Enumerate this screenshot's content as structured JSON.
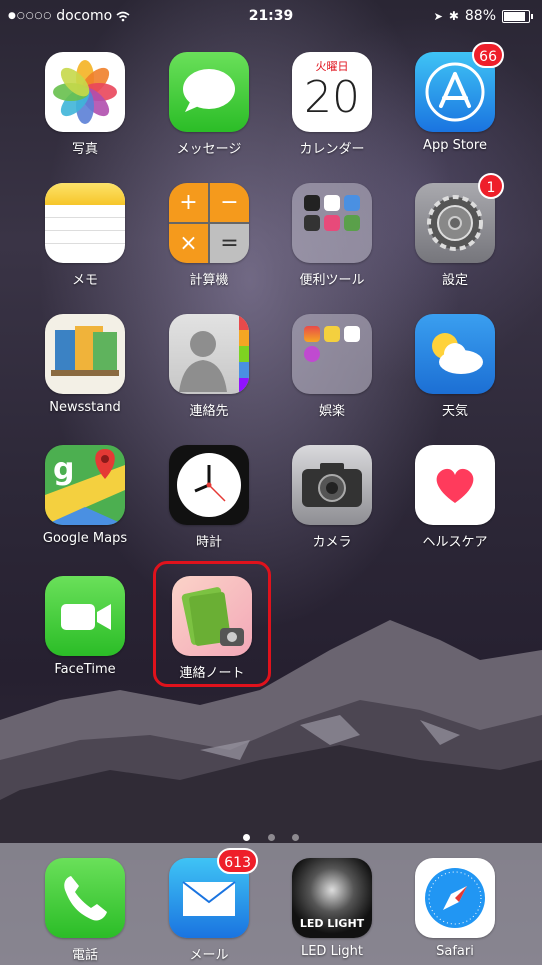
{
  "status_bar": {
    "carrier": "docomo",
    "time": "21:39",
    "battery": "88%"
  },
  "apps": [
    {
      "label": "写真",
      "icon": "photos-icon"
    },
    {
      "label": "メッセージ",
      "icon": "messages-icon"
    },
    {
      "label": "カレンダー",
      "icon": "calendar-icon",
      "weekday": "火曜日",
      "day": "20"
    },
    {
      "label": "App Store",
      "icon": "app-store-icon",
      "badge": "66"
    },
    {
      "label": "メモ",
      "icon": "notes-icon"
    },
    {
      "label": "計算機",
      "icon": "calculator-icon"
    },
    {
      "label": "便利ツール",
      "icon": "folder-icon"
    },
    {
      "label": "設定",
      "icon": "settings-icon",
      "badge": "1"
    },
    {
      "label": "Newsstand",
      "icon": "newsstand-icon"
    },
    {
      "label": "連絡先",
      "icon": "contacts-icon"
    },
    {
      "label": "娯楽",
      "icon": "folder-icon"
    },
    {
      "label": "天気",
      "icon": "weather-icon"
    },
    {
      "label": "Google Maps",
      "icon": "google-maps-icon"
    },
    {
      "label": "時計",
      "icon": "clock-icon"
    },
    {
      "label": "カメラ",
      "icon": "camera-icon"
    },
    {
      "label": "ヘルスケア",
      "icon": "health-icon"
    },
    {
      "label": "FaceTime",
      "icon": "facetime-icon"
    },
    {
      "label": "連絡ノート",
      "icon": "renraku-note-icon"
    }
  ],
  "dock": [
    {
      "label": "電話",
      "icon": "phone-icon"
    },
    {
      "label": "メール",
      "icon": "mail-icon",
      "badge": "613"
    },
    {
      "label": "LED Light",
      "icon": "led-light-icon",
      "icon_text": "LED LIGHT"
    },
    {
      "label": "Safari",
      "icon": "safari-icon"
    }
  ],
  "page_indicator": {
    "pages": 3,
    "current": 1
  }
}
